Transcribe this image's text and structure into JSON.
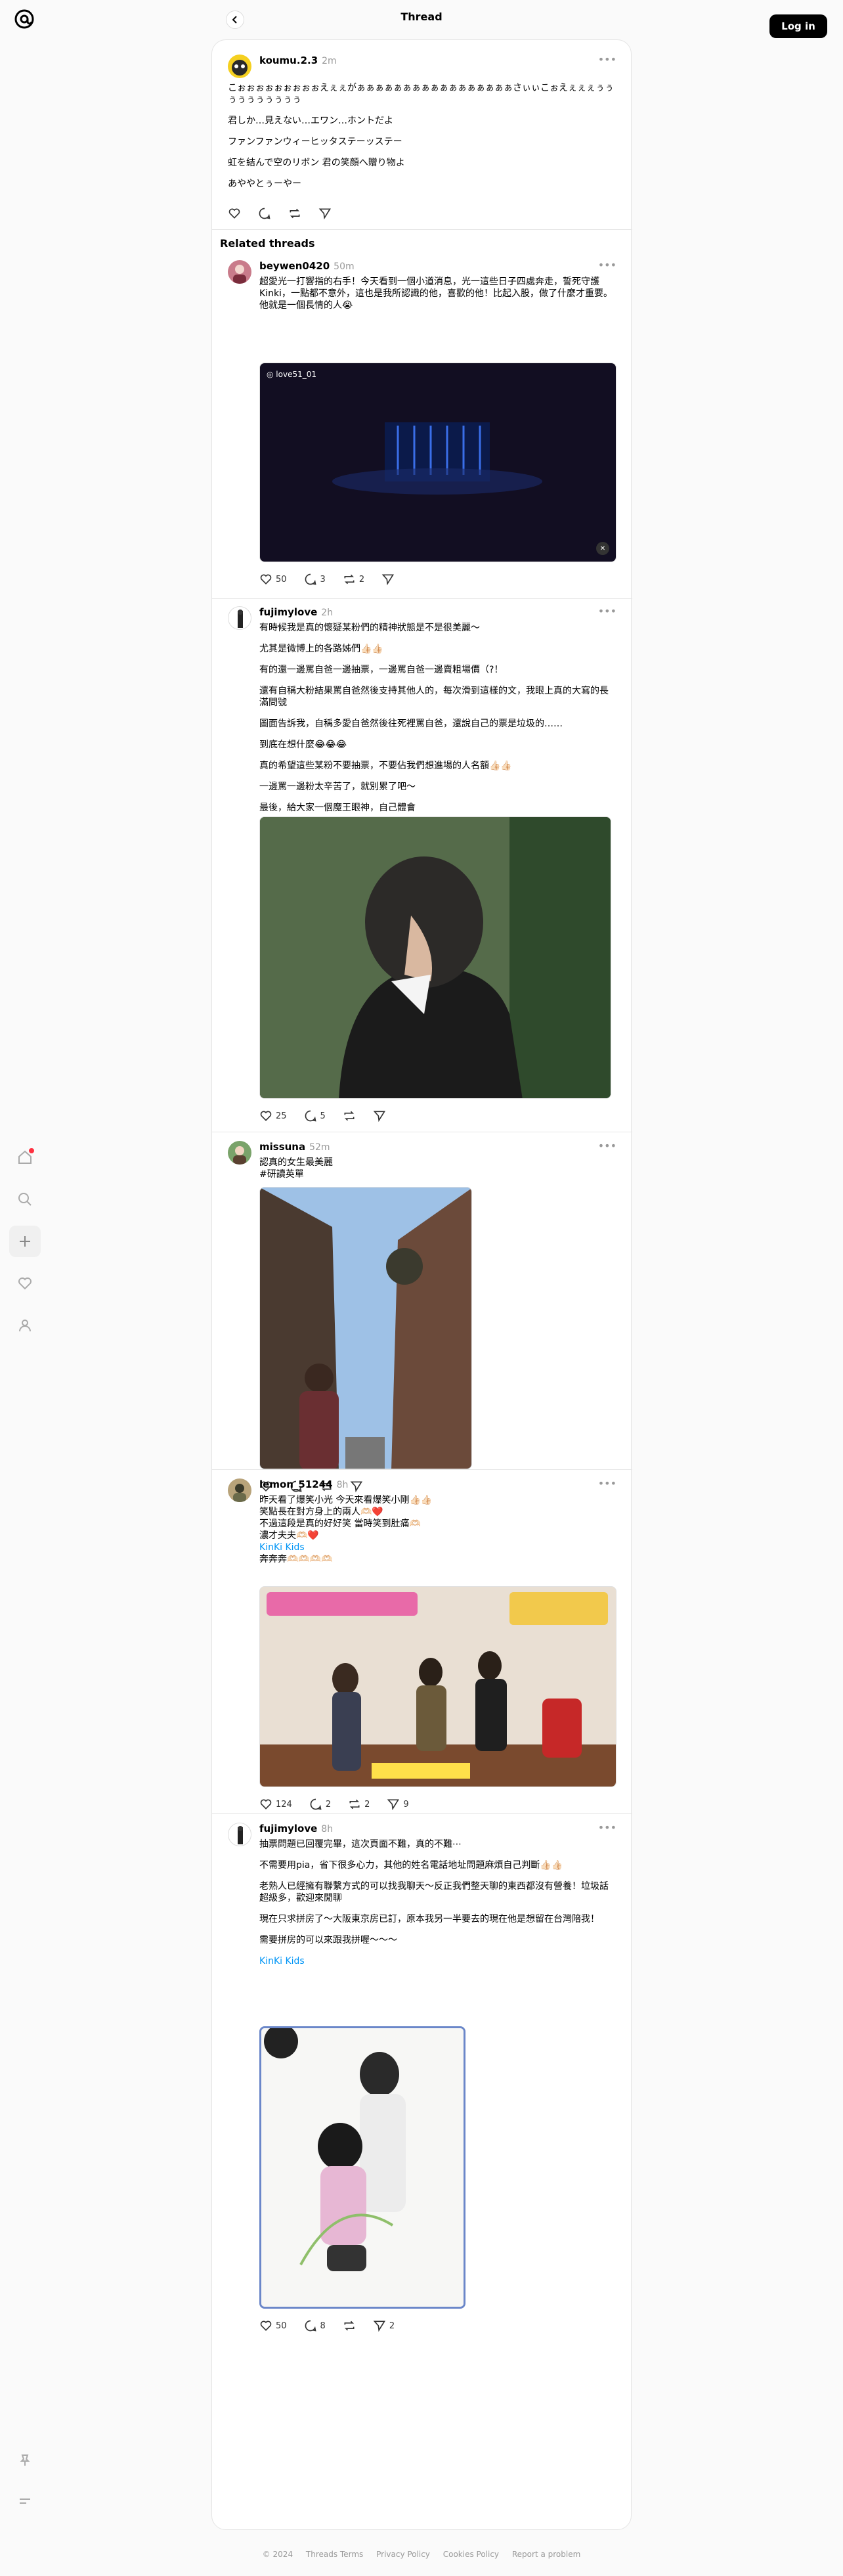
{
  "header": {
    "title": "Thread",
    "login": "Log in"
  },
  "main_post": {
    "username": "koumu.2.3",
    "time": "2m",
    "lines": [
      "こぉぉぉぉぉぉぉぉぉえぇぇがぁぁぁぁぁぁぁぁぁぁぁぁぁぁぁぁぁさぃぃこぉえぇぇぇぅぅぅぅぅぅぅぅぅぅ",
      "君しか…見えない…エワン…ホントだよ",
      "ファンファンウィーヒッタステーッステー",
      "虹を結んで空のリボン 君の笑顔へ贈り物よ",
      "あややとぅーやー"
    ]
  },
  "related_title": "Related threads",
  "posts": [
    {
      "username": "beywen0420",
      "time": "50m",
      "lines": [
        "超愛光一打響指的右手！今天看到一個小道消息，光一這些日子四處奔走，誓死守護Kinki，一點都不意外，這也是我所認識的他，喜歡的他！比起入股，做了什麼才重要。他就是一個長情的人😭"
      ],
      "video_user": "love51_01",
      "likes": "50",
      "replies": "3",
      "reposts": "2",
      "shares": ""
    },
    {
      "username": "fujimylove",
      "time": "2h",
      "lines": [
        "有時候我是真的懷疑某粉們的精神狀態是不是很美麗～",
        "尤其是微博上的各路姊們👍🏻👍🏻",
        "有的還一邊罵自爸一邊抽票，一邊罵自爸一邊賣粗場價（?！",
        "還有自稱大粉結果罵自爸然後支持其他人的，每次滑到這樣的文，我眼上真的大寫的長滿問號",
        "圖面告訴我，自稱多愛自爸然後往死裡罵自爸，還說自己的票是垃圾的……",
        "到底在想什麼😂😂😂",
        "真的希望這些某粉不要抽票，不要佔我們想進場的人名額👍🏻👍🏻",
        "一邊罵一邊粉太辛苦了，就別累了吧～",
        "最後，給大家一個魔王眼神，自己體會"
      ],
      "likes": "25",
      "replies": "5",
      "reposts": "",
      "shares": ""
    },
    {
      "username": "missuna",
      "time": "52m",
      "lines": [
        "認真的女生最美麗",
        "#研讀英單"
      ],
      "likes": "",
      "replies": "",
      "reposts": "",
      "shares": ""
    },
    {
      "username": "lemon_51244",
      "time": "8h",
      "lines": [
        "昨天看了爆笑小光 今天來看爆笑小剛👍🏻👍🏻",
        "笑點長在對方身上的兩人🫶🏻❤️",
        "不過這段是真的好好笑 當時笑到肚痛🫶🏻",
        "濃才夫夫🫶🏻❤️"
      ],
      "tag": "KinKi Kids",
      "extra": "奔奔奔🫶🏻🫶🏻🫶🏻🫶🏻",
      "likes": "124",
      "replies": "2",
      "reposts": "2",
      "shares": "9"
    },
    {
      "username": "fujimylove",
      "time": "8h",
      "lines": [
        "抽票問題已回覆完畢，這次頁面不難，真的不難⋯",
        "不需要用pia，省下很多心力，其他的姓名電話地址問題麻煩自己判斷👍🏻👍🏻",
        "老熟人已經擁有聯繫方式的可以找我聊天～反正我們整天聊的東西都沒有營養！垃圾話超級多，歡迎來閒聊",
        "現在只求拼房了～大阪東京房已訂，原本我另一半要去的現在他是想留在台灣陪我！",
        "需要拼房的可以來跟我拼喔～～～"
      ],
      "tag": "KinKi Kids",
      "likes": "50",
      "replies": "8",
      "reposts": "",
      "shares": "2"
    }
  ],
  "footer": [
    "© 2024",
    "Threads Terms",
    "Privacy Policy",
    "Cookies Policy",
    "Report a problem"
  ]
}
